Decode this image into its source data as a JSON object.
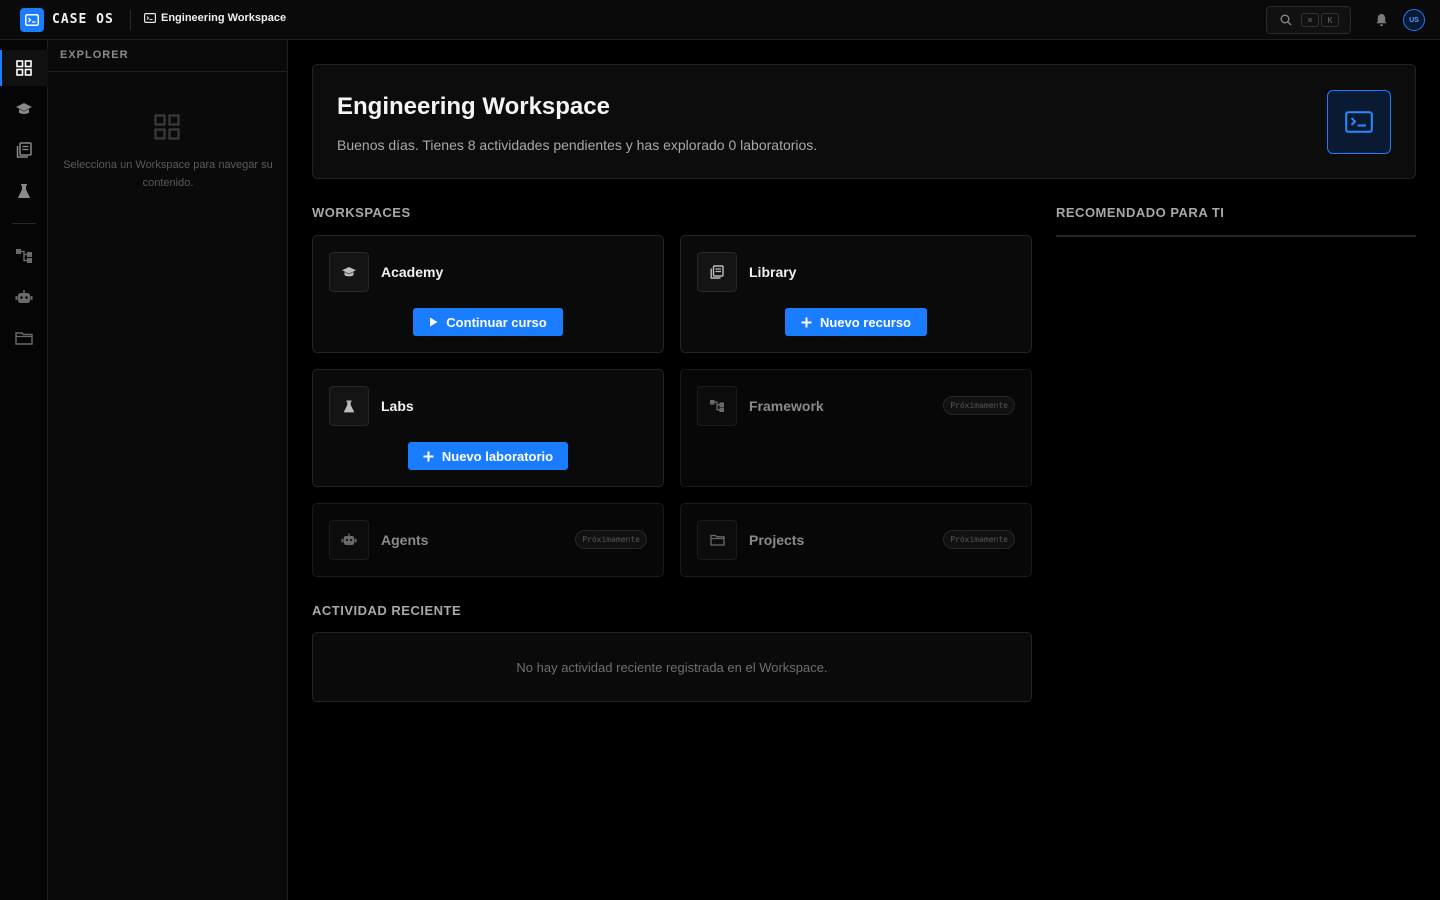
{
  "app": {
    "brand": "CASE OS",
    "breadcrumb": "Engineering Workspace"
  },
  "topbar": {
    "shortcut_keys": [
      "⌘",
      "K"
    ],
    "avatar_initials": "US"
  },
  "rail": {
    "items": [
      "dashboard-icon",
      "academy-icon",
      "library-icon",
      "labs-icon",
      "framework-icon",
      "agents-icon",
      "projects-icon"
    ],
    "active": "dashboard-icon"
  },
  "explorer": {
    "title": "EXPLORER",
    "empty_text": "Selecciona un Workspace para navegar su contenido."
  },
  "hero": {
    "title": "Engineering Workspace",
    "subtitle": "Buenos días. Tienes 8 actividades pendientes y has explorado 0 laboratorios."
  },
  "sections": {
    "workspaces": "WORKSPACES",
    "recommended": "RECOMENDADO PARA TI",
    "recent": "ACTIVIDAD RECIENTE"
  },
  "workspaces": [
    {
      "name": "Academy",
      "icon": "graduation-cap-icon",
      "button": "Continuar curso",
      "button_icon": "play-icon"
    },
    {
      "name": "Library",
      "icon": "library-icon",
      "button": "Nuevo recurso",
      "button_icon": "plus-icon"
    },
    {
      "name": "Labs",
      "icon": "flask-icon",
      "button": "Nuevo laboratorio",
      "button_icon": "plus-icon"
    },
    {
      "name": "Framework",
      "icon": "hierarchy-icon",
      "badge": "Próximamente"
    },
    {
      "name": "Agents",
      "icon": "robot-icon",
      "badge": "Próximamente"
    },
    {
      "name": "Projects",
      "icon": "folder-icon",
      "badge": "Próximamente"
    }
  ],
  "recent_activity": {
    "empty_text": "No hay actividad reciente registrada en el Workspace."
  },
  "colors": {
    "accent": "#1a7cff",
    "background": "#000000",
    "surface": "#0a0a0a",
    "border": "#232323"
  }
}
